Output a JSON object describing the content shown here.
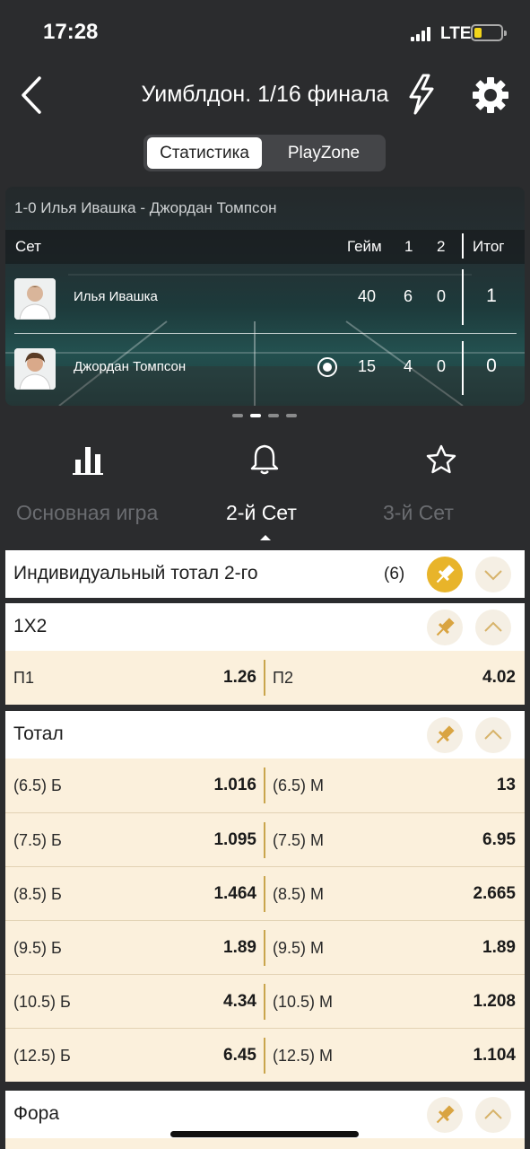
{
  "status": {
    "time": "17:28",
    "carrier": "LTE"
  },
  "header": {
    "title": "Уимблдон. 1/16 финала"
  },
  "segmented": {
    "active": "Статистика",
    "other": "PlayZone"
  },
  "scoreboard": {
    "match": "1-0  Илья Ивашка - Джордан Томпсон",
    "col_set": "Сет",
    "col_game": "Гейм",
    "col_1": "1",
    "col_2": "2",
    "col_total": "Итог",
    "players": [
      {
        "name": "Илья Ивашка",
        "game": "40",
        "s1": "6",
        "s2": "0",
        "total": "1",
        "serving": false
      },
      {
        "name": "Джордан Томпсон",
        "game": "15",
        "s1": "4",
        "s2": "0",
        "total": "0",
        "serving": true
      }
    ]
  },
  "icons": [
    "stats-icon",
    "bell-icon",
    "star-icon"
  ],
  "tabs": {
    "left": "Основная игра",
    "active": "2-й Сет",
    "right": "3-й Сет"
  },
  "markets": {
    "individual": {
      "title": "Индивидуальный тотал 2-го",
      "count": "(6)"
    },
    "onextwo": {
      "title": "1X2",
      "rows": [
        {
          "l1": "П1",
          "v1": "1.26",
          "l2": "П2",
          "v2": "4.02"
        }
      ]
    },
    "total": {
      "title": "Тотал",
      "rows": [
        {
          "l1": "(6.5) Б",
          "v1": "1.016",
          "l2": "(6.5) М",
          "v2": "13"
        },
        {
          "l1": "(7.5) Б",
          "v1": "1.095",
          "l2": "(7.5) М",
          "v2": "6.95"
        },
        {
          "l1": "(8.5) Б",
          "v1": "1.464",
          "l2": "(8.5) М",
          "v2": "2.665"
        },
        {
          "l1": "(9.5) Б",
          "v1": "1.89",
          "l2": "(9.5) М",
          "v2": "1.89"
        },
        {
          "l1": "(10.5) Б",
          "v1": "4.34",
          "l2": "(10.5) М",
          "v2": "1.208"
        },
        {
          "l1": "(12.5) Б",
          "v1": "6.45",
          "l2": "(12.5) М",
          "v2": "1.104"
        }
      ]
    },
    "handicap": {
      "title": "Фора"
    }
  },
  "colors": {
    "accent": "#e8b42a",
    "odds_bg": "#fbf0dc",
    "background": "#2b2c2e"
  }
}
